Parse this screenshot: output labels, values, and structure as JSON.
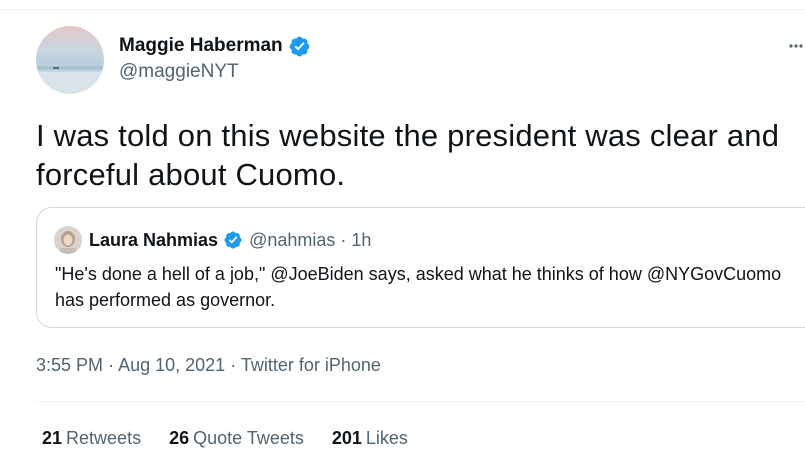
{
  "tweet": {
    "author": {
      "name": "Maggie Haberman",
      "handle": "@maggieNYT",
      "verified": true
    },
    "more_icon": "more-horizontal-icon",
    "text": "I was told on this website the president was clear and forceful about Cuomo.",
    "quoted": {
      "name": "Laura Nahmias",
      "handle": "@nahmias",
      "separator": "·",
      "time": "1h",
      "text": "\"He's done a hell of a job,\" @JoeBiden says, asked what he thinks of how @NYGovCuomo has performed as governor."
    },
    "meta": {
      "time": "3:55 PM",
      "separator": "·",
      "date": "Aug 10, 2021",
      "source": "Twitter for iPhone"
    },
    "stats": {
      "retweets": {
        "count": "21",
        "label": "Retweets"
      },
      "quote_tweets": {
        "count": "26",
        "label": "Quote Tweets"
      },
      "likes": {
        "count": "201",
        "label": "Likes"
      }
    }
  },
  "colors": {
    "text_primary": "#0f1419",
    "text_secondary": "#536471",
    "verified_blue": "#1d9bf0",
    "border": "#cfd9de",
    "divider": "#eff3f4"
  }
}
